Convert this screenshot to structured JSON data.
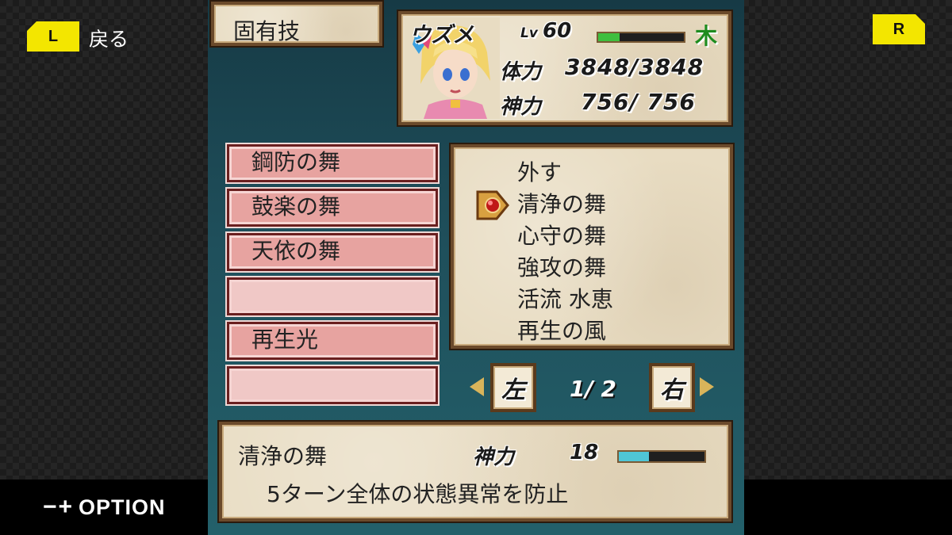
{
  "nav": {
    "l_key": "L",
    "back_label": "戻る",
    "r_key": "R",
    "option_symbols": "−+",
    "option_label": "OPTION"
  },
  "menu": {
    "title": "固有技"
  },
  "character": {
    "name": "ウズメ",
    "lv_label": "Lv",
    "lv": "60",
    "lv_progress": 0.25,
    "element": "木",
    "hp_label": "体力",
    "hp": "3848/3848",
    "mp_label": "神力",
    "mp": "756/ 756"
  },
  "equipped_slots": [
    {
      "label": "鋼防の舞"
    },
    {
      "label": "鼓楽の舞"
    },
    {
      "label": "天依の舞"
    },
    {
      "label": ""
    },
    {
      "label": "再生光"
    },
    {
      "label": ""
    }
  ],
  "skill_list": [
    {
      "label": "外す"
    },
    {
      "label": "清浄の舞"
    },
    {
      "label": "心守の舞"
    },
    {
      "label": "強攻の舞"
    },
    {
      "label": "活流 水恵"
    },
    {
      "label": "再生の風"
    }
  ],
  "pager": {
    "left_label": "左",
    "right_label": "右",
    "page": "1/ 2"
  },
  "description": {
    "skill_name": "清浄の舞",
    "cost_label": "神力",
    "cost": "18",
    "cost_ratio": 0.35,
    "text": "5ターン全体の状態異常を防止"
  },
  "colors": {
    "accent_yellow": "#f3e600",
    "slot_pink": "#e7a3a0",
    "element_green": "#1e8c1e"
  }
}
